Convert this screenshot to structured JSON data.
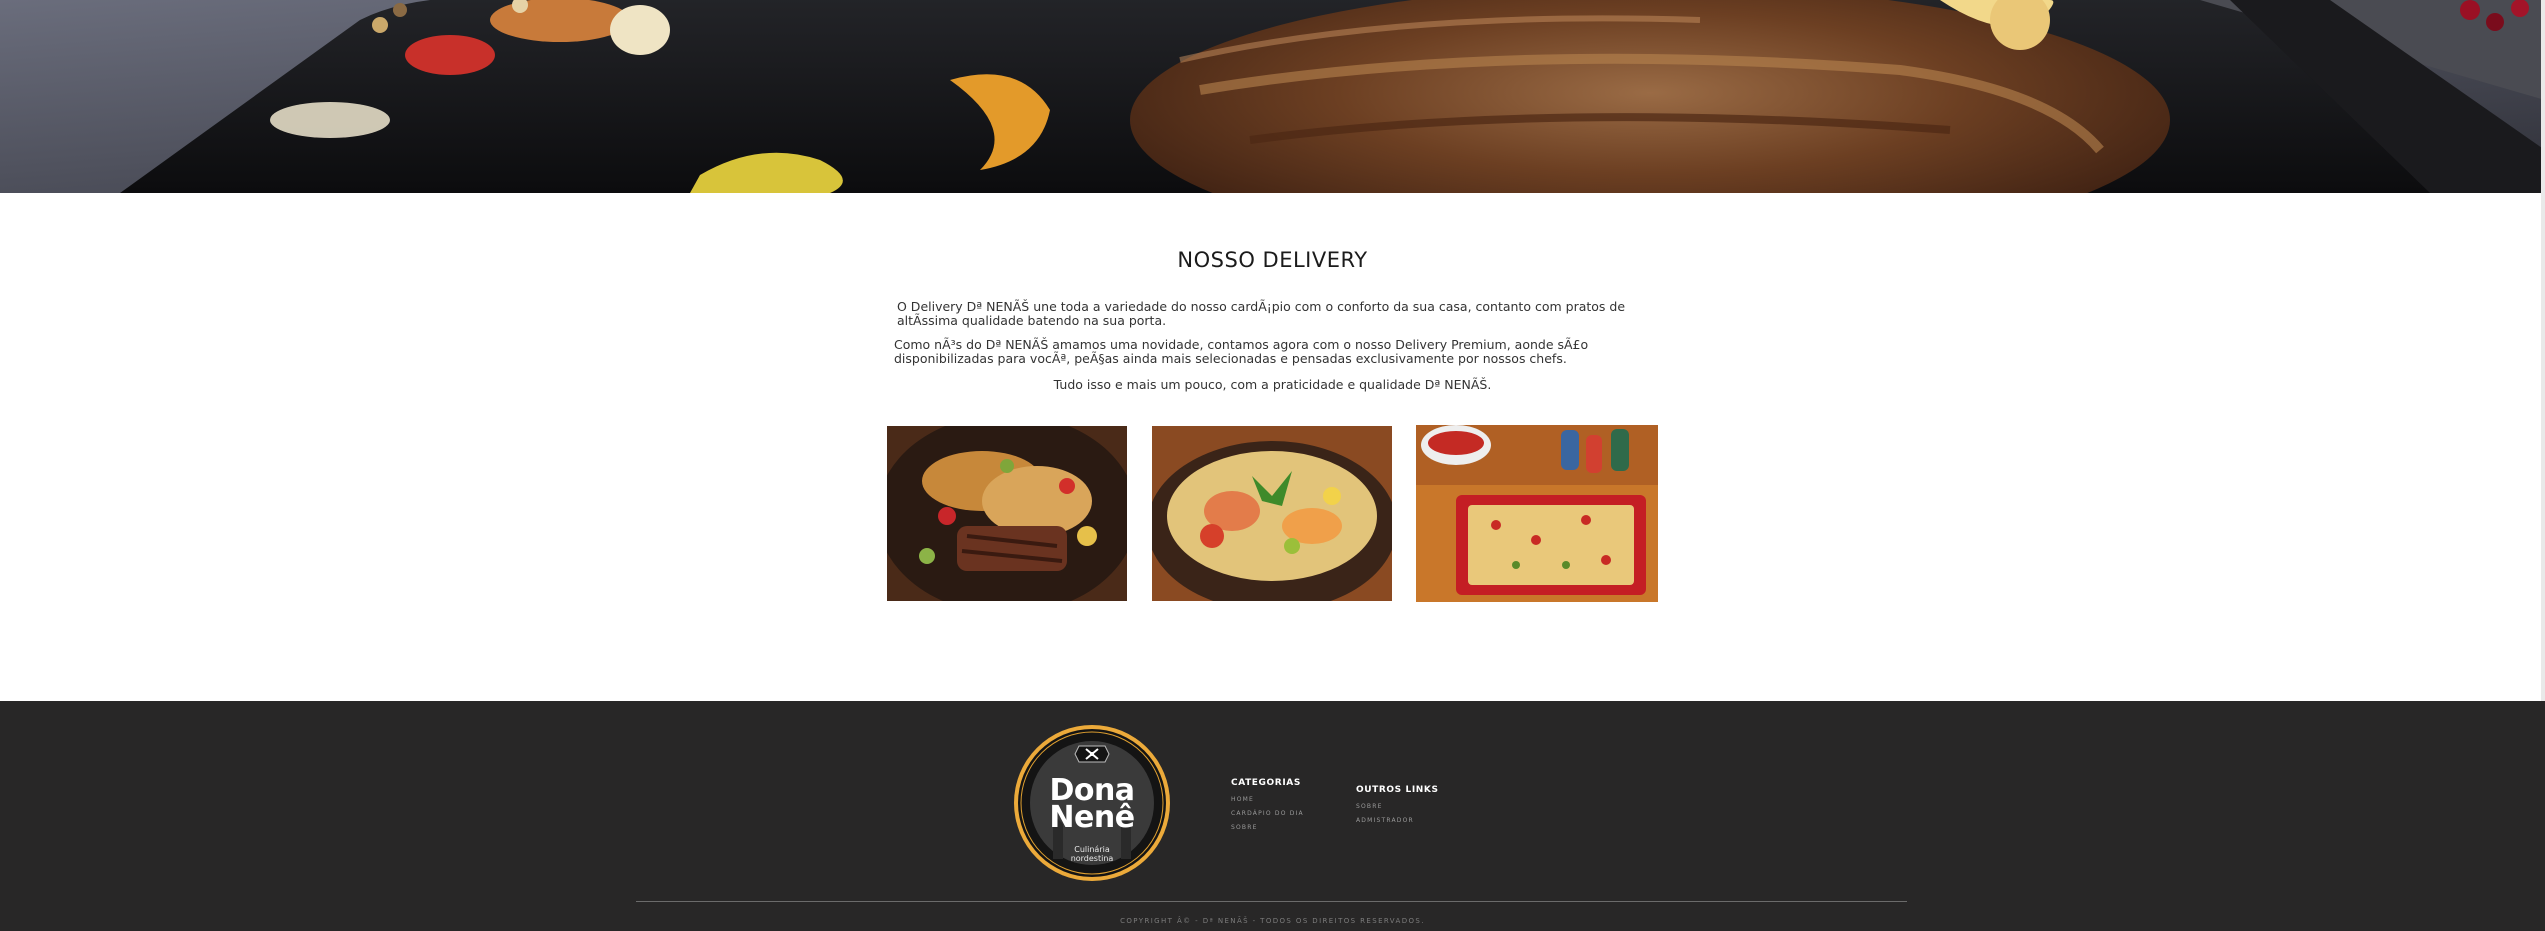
{
  "section": {
    "title": "NOSSO DELIVERY",
    "paragraphs": [
      "O Delivery Dª NENÃŠ une toda a variedade do nosso cardÃ¡pio com o conforto da sua casa, contanto com pratos de altÃ­ssima qualidade batendo na sua porta.",
      "Como nÃ³s do Dª NENÃŠ amamos uma novidade, contamos agora com o nosso Delivery Premium, aonde sÃ£o disponibilizadas para vocÃª, peÃ§as ainda mais selecionadas e pensadas exclusivamente por nossos chefs.",
      "Tudo isso e mais um pouco, com a praticidade e qualidade Dª NENÃŠ."
    ]
  },
  "photos": [
    {
      "icon": "grilled-meat-dish-photo"
    },
    {
      "icon": "stew-dish-photo"
    },
    {
      "icon": "rice-casserole-photo"
    }
  ],
  "footer": {
    "logo": {
      "line1": "Dona",
      "line2": "Nenê",
      "sub1": "Culinária",
      "sub2": "nordestina"
    },
    "columns": [
      {
        "title": "CATEGORIAS",
        "links": [
          "HOME",
          "CARDÁPIO DO DIA",
          "SOBRE"
        ]
      },
      {
        "title": "OUTROS LINKS",
        "links": [
          "SOBRE",
          "ADMISTRADOR"
        ]
      }
    ],
    "copyright": "COPYRIGHT Â© - Dª NENÃŠ - TODOS OS DIREITOS RESERVADOS."
  },
  "colors": {
    "footer_bg": "#282727",
    "logo_ring": "#e0a030",
    "title_text": "#1b1b1b"
  }
}
